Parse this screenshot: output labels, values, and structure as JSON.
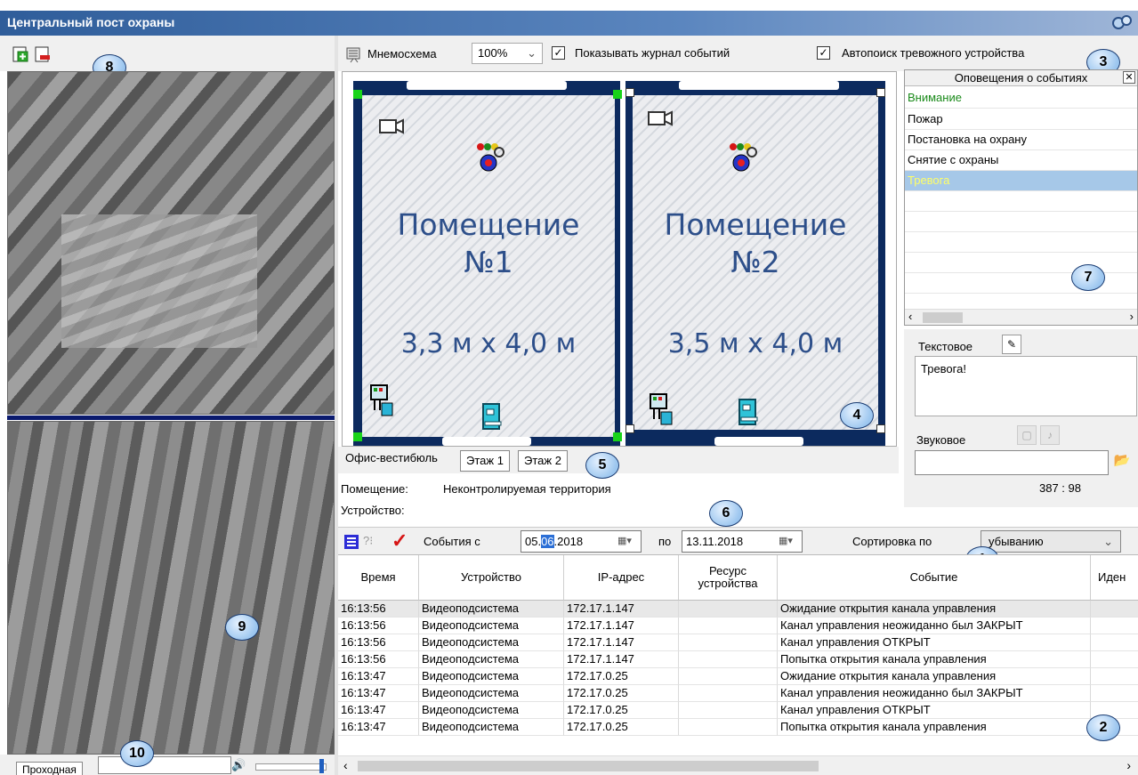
{
  "window": {
    "title": "Центральный пост охраны",
    "icon": "settings-icon"
  },
  "mnemo_toolbar": {
    "mnemo_label": "Мнемосхема",
    "zoom": "100%",
    "show_log_label": "Показывать журнал событий",
    "show_log_checked": true,
    "autosearch_label": "Автопоиск тревожного устройства",
    "autosearch_checked": true
  },
  "rooms": [
    {
      "name": "Помещение",
      "number": "№1",
      "size": "3,3 м х 4,0 м"
    },
    {
      "name": "Помещение",
      "number": "№2",
      "size": "3,5 м х 4,0 м"
    }
  ],
  "floor_tabs": [
    "Офис-вестибюль",
    "Этаж 1",
    "Этаж 2"
  ],
  "active_floor_tab": 0,
  "notifications": {
    "title": "Оповещения о событиях",
    "items": [
      {
        "label": "Внимание",
        "color": "#1a8a1a"
      },
      {
        "label": "Пожар",
        "color": "#000000"
      },
      {
        "label": "Постановка на охрану",
        "color": "#000000"
      },
      {
        "label": "Снятие с охраны",
        "color": "#000000"
      },
      {
        "label": "Тревога",
        "color": "#ffff66",
        "selected": true
      }
    ],
    "selected_bg": "#a6c8e8"
  },
  "text_notification": {
    "label": "Текстовое",
    "value": "Тревога!"
  },
  "sound_notification": {
    "label": "Звуковое",
    "value": ""
  },
  "coords": "387 : 98",
  "room_info": {
    "label": "Помещение:",
    "value": "Неконтролируемая территория"
  },
  "device_info": {
    "label": "Устройство:"
  },
  "events_toolbar": {
    "from_label": "События с",
    "date_from_pre": "05.",
    "date_from_sel": "06",
    "date_from_post": ".2018",
    "to_label": "по",
    "date_to": "13.11.2018",
    "sort_label": "Сортировка по",
    "sort_value": "убыванию"
  },
  "events_table": {
    "columns": [
      "Время",
      "Устройство",
      "IP-адрес",
      "Ресурс устройства",
      "Событие",
      "Иден"
    ],
    "rows": [
      [
        "16:13:56",
        "Видеоподсистема",
        "172.17.1.147",
        "",
        "Ожидание открытия канала управления"
      ],
      [
        "16:13:56",
        "Видеоподсистема",
        "172.17.1.147",
        "",
        "Канал управления неожиданно был ЗАКРЫТ"
      ],
      [
        "16:13:56",
        "Видеоподсистема",
        "172.17.1.147",
        "",
        "Канал управления ОТКРЫТ"
      ],
      [
        "16:13:56",
        "Видеоподсистема",
        "172.17.1.147",
        "",
        "Попытка открытия канала управления"
      ],
      [
        "16:13:47",
        "Видеоподсистема",
        "172.17.0.25",
        "",
        "Ожидание открытия канала управления"
      ],
      [
        "16:13:47",
        "Видеоподсистема",
        "172.17.0.25",
        "",
        "Канал управления неожиданно был ЗАКРЫТ"
      ],
      [
        "16:13:47",
        "Видеоподсистема",
        "172.17.0.25",
        "",
        "Канал управления ОТКРЫТ"
      ],
      [
        "16:13:47",
        "Видеоподсистема",
        "172.17.0.25",
        "",
        "Попытка открытия канала управления"
      ]
    ]
  },
  "video": {
    "tab_label": "Проходная"
  },
  "callouts": [
    "1",
    "2",
    "3",
    "4",
    "5",
    "6",
    "7",
    "8",
    "9",
    "10"
  ]
}
